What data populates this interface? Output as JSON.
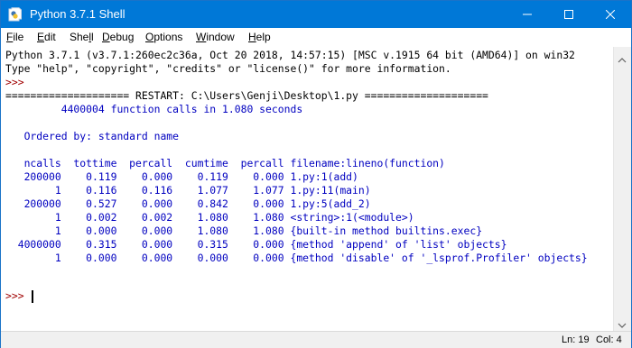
{
  "window": {
    "title": "Python 3.7.1 Shell",
    "titlebar_color": "#0078d7"
  },
  "menu": {
    "items": [
      {
        "label": "File",
        "underline": "F",
        "rest": "ile"
      },
      {
        "label": "Edit",
        "underline": "E",
        "rest": "dit"
      },
      {
        "label": "Shell",
        "pre": "She",
        "underline": "l",
        "rest": "l"
      },
      {
        "label": "Debug",
        "underline": "D",
        "rest": "ebug"
      },
      {
        "label": "Options",
        "underline": "O",
        "rest": "ptions"
      },
      {
        "label": "Window",
        "underline": "W",
        "rest": "indow"
      },
      {
        "label": "Help",
        "underline": "H",
        "rest": "elp"
      }
    ]
  },
  "shell": {
    "banner_line1": "Python 3.7.1 (v3.7.1:260ec2c36a, Oct 20 2018, 14:57:15) [MSC v.1915 64 bit (AMD64)] on win32",
    "banner_line2": "Type \"help\", \"copyright\", \"credits\" or \"license()\" for more information.",
    "prompt": ">>> ",
    "restart_line": "==================== RESTART: C:\\Users\\Genji\\Desktop\\1.py ====================",
    "summary": "         4400004 function calls in 1.080 seconds",
    "blank": "",
    "ordered_by": "   Ordered by: standard name",
    "header": "   ncalls  tottime  percall  cumtime  percall filename:lineno(function)",
    "rows": [
      "   200000    0.119    0.000    0.119    0.000 1.py:1(add)",
      "        1    0.116    0.116    1.077    1.077 1.py:11(main)",
      "   200000    0.527    0.000    0.842    0.000 1.py:5(add_2)",
      "        1    0.002    0.002    1.080    1.080 <string>:1(<module>)",
      "        1    0.000    0.000    1.080    1.080 {built-in method builtins.exec}",
      "  4000000    0.315    0.000    0.315    0.000 {method 'append' of 'list' objects}",
      "        1    0.000    0.000    0.000    0.000 {method 'disable' of '_lsprof.Profiler' objects}"
    ],
    "final_prompt": ">>> ",
    "colors": {
      "stdout": "#0000c0",
      "prompt": "#a00000",
      "text": "#000000"
    }
  },
  "status": {
    "line": "Ln: 19",
    "col": "Col: 4"
  }
}
